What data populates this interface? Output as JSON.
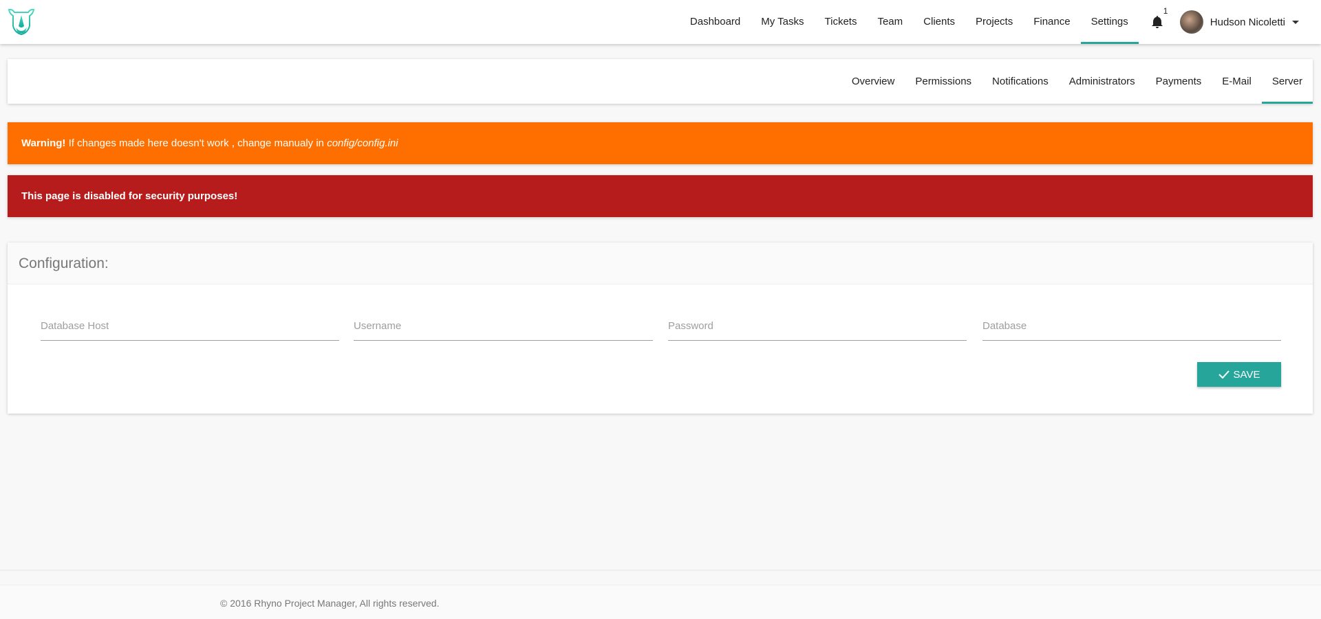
{
  "header": {
    "logo": "rhino-logo",
    "nav": [
      {
        "label": "Dashboard"
      },
      {
        "label": "My Tasks"
      },
      {
        "label": "Tickets"
      },
      {
        "label": "Team"
      },
      {
        "label": "Clients"
      },
      {
        "label": "Projects"
      },
      {
        "label": "Finance"
      },
      {
        "label": "Settings",
        "active": true
      }
    ],
    "notification_count": "1",
    "user_name": "Hudson Nicoletti"
  },
  "subnav": [
    {
      "label": "Overview"
    },
    {
      "label": "Permissions"
    },
    {
      "label": "Notifications"
    },
    {
      "label": "Administrators"
    },
    {
      "label": "Payments"
    },
    {
      "label": "E-Mail"
    },
    {
      "label": "Server",
      "active": true
    }
  ],
  "alerts": {
    "warning_strong": "Warning!",
    "warning_text": " If changes made here doesn't work , change manualy in ",
    "warning_path": "config/config.ini",
    "danger": "This page is disabled for security purposes!"
  },
  "config": {
    "title": "Configuration:",
    "fields": [
      {
        "placeholder": "Database Host",
        "value": ""
      },
      {
        "placeholder": "Username",
        "value": ""
      },
      {
        "placeholder": "Password",
        "value": ""
      },
      {
        "placeholder": "Database",
        "value": ""
      }
    ],
    "save_label": "Save"
  },
  "footer": {
    "text": "© 2016 Rhyno Project Manager, All rights reserved."
  },
  "colors": {
    "accent": "#26a69a",
    "warning": "#ff6f00",
    "danger": "#b71c1c"
  }
}
